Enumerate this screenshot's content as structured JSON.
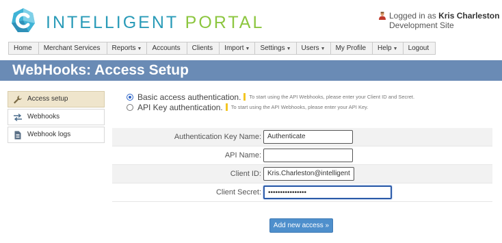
{
  "brand": {
    "word1": "INTELLIGENT",
    "word2": "PORTAL"
  },
  "user": {
    "prefix": "Logged in as ",
    "name": "Kris Charleston",
    "site": "Development Site"
  },
  "nav": {
    "items": [
      {
        "label": "Home",
        "caret": ""
      },
      {
        "label": "Merchant Services",
        "caret": ""
      },
      {
        "label": "Reports",
        "caret": "▼"
      },
      {
        "label": "Accounts",
        "caret": ""
      },
      {
        "label": "Clients",
        "caret": ""
      },
      {
        "label": "Import",
        "caret": "▼"
      },
      {
        "label": "Settings",
        "caret": "▼"
      },
      {
        "label": "Users",
        "caret": "▼"
      },
      {
        "label": "My Profile",
        "caret": ""
      },
      {
        "label": "Help",
        "caret": "▼"
      },
      {
        "label": "Logout",
        "caret": ""
      }
    ]
  },
  "page_title": "WebHooks: Access Setup",
  "sidebar": {
    "items": [
      {
        "label": "Access setup",
        "icon": "wrench-icon"
      },
      {
        "label": "Webhooks",
        "icon": "transfer-arrows-icon"
      },
      {
        "label": "Webhook logs",
        "icon": "document-icon"
      }
    ]
  },
  "auth": {
    "options": [
      {
        "label": "Basic access authentication.",
        "hint": "To start using the API Webhooks, please enter your Client ID and Secret.",
        "checked": true
      },
      {
        "label": "API Key authentication.",
        "hint": "To start using the API Webhooks, please enter your API Key.",
        "checked": false
      }
    ]
  },
  "form": {
    "fields": [
      {
        "label": "Authentication Key Name:",
        "value": "Authenticate"
      },
      {
        "label": "API Name:",
        "value": ""
      },
      {
        "label": "Client ID:",
        "value": "Kris.Charleston@intelligent"
      },
      {
        "label": "Client Secret:",
        "value": "••••••••••••••••"
      }
    ],
    "submit_label": "Add new access »"
  },
  "colors": {
    "brand_blue": "#2a9bb8",
    "brand_green": "#8cc63f",
    "title_bar": "#6a8bb5",
    "button": "#4e8fcc"
  }
}
